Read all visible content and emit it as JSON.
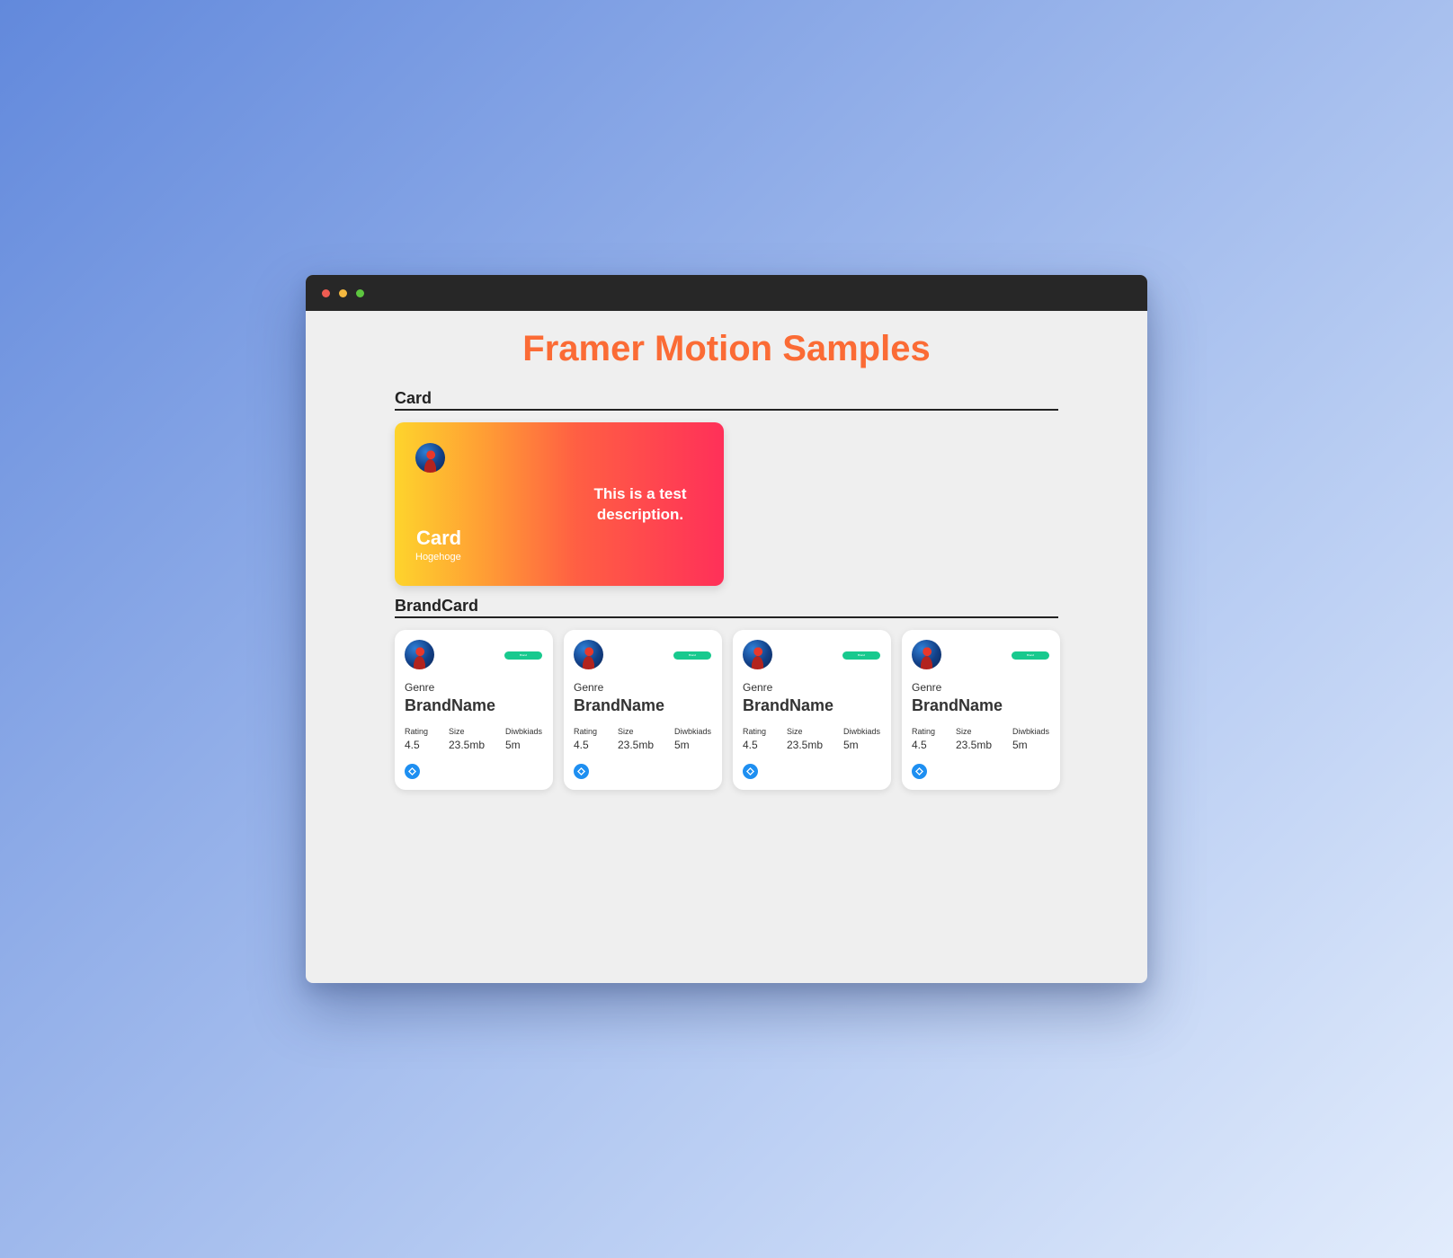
{
  "window": {
    "controls": [
      "close",
      "minimize",
      "maximize"
    ]
  },
  "page": {
    "title": "Framer Motion Samples"
  },
  "sections": {
    "card": {
      "heading": "Card",
      "avatar_icon": "avatar-image",
      "description": "This is a test description.",
      "title": "Card",
      "subtitle": "Hogehoge",
      "gradient_colors": [
        "#fed42c",
        "#ff9c35",
        "#ff5f43",
        "#ff3059"
      ]
    },
    "brandcard": {
      "heading": "BrandCard",
      "cards": [
        {
          "badge": "Brand",
          "genre": "Genre",
          "name": "BrandName",
          "stats": [
            {
              "label": "Rating",
              "value": "4.5"
            },
            {
              "label": "Size",
              "value": "23.5mb"
            },
            {
              "label": "Diwbkiads",
              "value": "5m"
            }
          ],
          "icon": "diamond-icon"
        },
        {
          "badge": "Brand",
          "genre": "Genre",
          "name": "BrandName",
          "stats": [
            {
              "label": "Rating",
              "value": "4.5"
            },
            {
              "label": "Size",
              "value": "23.5mb"
            },
            {
              "label": "Diwbkiads",
              "value": "5m"
            }
          ],
          "icon": "diamond-icon"
        },
        {
          "badge": "Brand",
          "genre": "Genre",
          "name": "BrandName",
          "stats": [
            {
              "label": "Rating",
              "value": "4.5"
            },
            {
              "label": "Size",
              "value": "23.5mb"
            },
            {
              "label": "Diwbkiads",
              "value": "5m"
            }
          ],
          "icon": "diamond-icon"
        },
        {
          "badge": "Brand",
          "genre": "Genre",
          "name": "BrandName",
          "stats": [
            {
              "label": "Rating",
              "value": "4.5"
            },
            {
              "label": "Size",
              "value": "23.5mb"
            },
            {
              "label": "Diwbkiads",
              "value": "5m"
            }
          ],
          "icon": "diamond-icon"
        }
      ]
    }
  },
  "colors": {
    "title": "#fb6b35",
    "badge": "#18c98e",
    "icon": "#1e8ff1",
    "titlebar": "#272727"
  }
}
